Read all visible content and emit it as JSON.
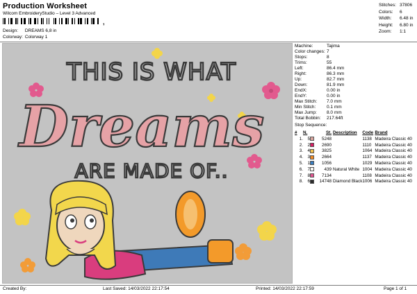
{
  "header": {
    "title": "Production Worksheet",
    "subtitle": "Wilcom EmbroideryStudio – Level 3 Advanced",
    "design_label": "Design:",
    "design_value": "DREAMS 6,8 in",
    "colorway_label": "Colorway:",
    "colorway_value": "Colorway 1"
  },
  "stats": [
    {
      "label": "Stitches:",
      "value": "37806"
    },
    {
      "label": "Colors:",
      "value": "6"
    },
    {
      "label": "Width:",
      "value": "6.48 in"
    },
    {
      "label": "Height:",
      "value": "6.80 in"
    },
    {
      "label": "Zoom:",
      "value": "1:1"
    }
  ],
  "machine_info": [
    {
      "label": "Machine:",
      "value": "Tajima"
    },
    {
      "label": "Color changes:",
      "value": "7"
    },
    {
      "label": "Stops:",
      "value": "8"
    },
    {
      "label": "Trims:",
      "value": "55"
    },
    {
      "label": "Left:",
      "value": "86.4 mm"
    },
    {
      "label": "Right:",
      "value": "86.3 mm"
    },
    {
      "label": "Up:",
      "value": "82.7 mm"
    },
    {
      "label": "Down:",
      "value": "81.9 mm"
    },
    {
      "label": "EndX:",
      "value": "0.00 in"
    },
    {
      "label": "EndY:",
      "value": "0.00 in"
    },
    {
      "label": "Max Stitch:",
      "value": "7.0 mm"
    },
    {
      "label": "Min Stitch:",
      "value": "0.1 mm"
    },
    {
      "label": "Max Jump:",
      "value": "8.0 mm"
    },
    {
      "label": "Total Bobbin:",
      "value": "217.64ft"
    }
  ],
  "stop_sequence": {
    "heading": "Stop Sequence:",
    "columns": {
      "num": "#",
      "n": "N.",
      "st": "St.",
      "desc": "Description",
      "code": "Code",
      "brand": "Brand"
    },
    "rows": [
      {
        "num": "1.",
        "n": "5",
        "color": "#d9a59e",
        "st": "5248",
        "desc": "",
        "code": "1138",
        "brand": "Madeira Classic 40"
      },
      {
        "num": "2.",
        "n": "2",
        "color": "#d91e63",
        "st": "2690",
        "desc": "",
        "code": "1110",
        "brand": "Madeira Classic 40"
      },
      {
        "num": "3.",
        "n": "4",
        "color": "#f2c14e",
        "st": "3825",
        "desc": "",
        "code": "1064",
        "brand": "Madeira Classic 40"
      },
      {
        "num": "4.",
        "n": "3",
        "color": "#f08a24",
        "st": "2664",
        "desc": "",
        "code": "1137",
        "brand": "Madeira Classic 40"
      },
      {
        "num": "5.",
        "n": "1",
        "color": "#3a7fc1",
        "st": "1056",
        "desc": "",
        "code": "1029",
        "brand": "Madeira Classic 40"
      },
      {
        "num": "6.",
        "n": "7",
        "color": "#f7f7f2",
        "st": "439",
        "desc": "Natural White",
        "code": "1004",
        "brand": "Madeira Classic 40"
      },
      {
        "num": "7.",
        "n": "8",
        "color": "#e35591",
        "st": "7134",
        "desc": "",
        "code": "1108",
        "brand": "Madeira Classic 40"
      },
      {
        "num": "8.",
        "n": "6",
        "color": "#2b2b2b",
        "st": "14748",
        "desc": "Diamond Black",
        "code": "1006",
        "brand": "Madeira Classic 40"
      }
    ]
  },
  "artwork": {
    "line1": "THIS IS WHAT",
    "line2": "Dreams",
    "line3": "ARE MADE OF..",
    "colors": {
      "background": "#c3c3c3",
      "outline": "#3a3a3a",
      "dreams_fill": "#e6a2a6",
      "flower_pink": "#e25a8e",
      "flower_yellow": "#f3d54a",
      "flower_orange": "#f29c38",
      "hair": "#f2d74c",
      "skin": "#efd7bd",
      "shirt": "#d93d7e",
      "jeans": "#3e7ab8",
      "shoe": "#f39a2a"
    }
  },
  "footer": {
    "created_by": "Created By:",
    "last_saved": "Last Saved: 14/03/2022 22:17:54",
    "printed": "Printed: 14/03/2022 22:17:59",
    "page": "Page 1 of 1"
  }
}
